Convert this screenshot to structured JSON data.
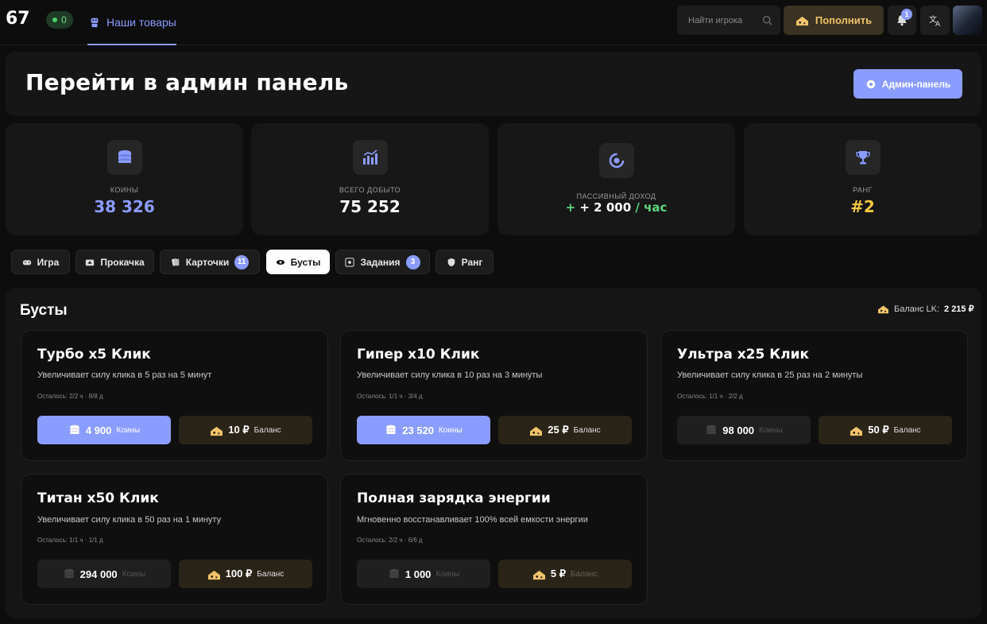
{
  "header": {
    "logo": "67",
    "online_count": "0",
    "nav_tab": "Наши товары",
    "search_placeholder": "Найти игрока",
    "topup_label": "Пополнить",
    "notifications_count": "1",
    "colors": {
      "accent": "#8b9cff",
      "gold": "#f1c46b",
      "online": "#42d26a"
    }
  },
  "admin": {
    "title": "Перейти в админ панель",
    "button_label": "Админ-панель"
  },
  "stats": [
    {
      "label": "Коины",
      "value": "38 326",
      "color": "#8b9cff",
      "icon": "coins-icon"
    },
    {
      "label": "Всего добыто",
      "value": "75 252",
      "color": "#ffffff",
      "icon": "chart-icon"
    },
    {
      "label": "Пассивный доход",
      "value_main": "+ 2 000",
      "value_unit": "/ час",
      "color": "#5fd67b",
      "icon": "passive-icon"
    },
    {
      "label": "Ранг",
      "value": "#2",
      "color": "#f5c842",
      "icon": "trophy-icon"
    }
  ],
  "tabs": [
    {
      "label": "Игра",
      "icon": "gamepad-icon"
    },
    {
      "label": "Прокачка",
      "icon": "upgrade-icon"
    },
    {
      "label": "Карточки",
      "badge": "11",
      "icon": "cards-icon"
    },
    {
      "label": "Бусты",
      "active": true,
      "icon": "boost-icon"
    },
    {
      "label": "Задания",
      "badge": "3",
      "icon": "tasks-icon"
    },
    {
      "label": "Ранг",
      "icon": "shield-icon"
    }
  ],
  "boosts": {
    "title": "Бусты",
    "balance_label": "Баланс LK:",
    "balance_value": "2 215 ₽",
    "cards": [
      {
        "title": "Турбо x5 Клик",
        "desc": "Увеличивает силу клика в 5 раз на 5 минут",
        "left": "Осталось: 2/2 ч · 8/8 д",
        "coins_price": "4 900",
        "coins_unit": "Коины",
        "coins_enabled": true,
        "rub_price": "10 ₽",
        "rub_unit": "Баланс",
        "rub_enabled": true
      },
      {
        "title": "Гипер x10 Клик",
        "desc": "Увеличивает силу клика в 10 раз на 3 минуты",
        "left": "Осталось: 1/1 ч · 3/4 д",
        "coins_price": "23 520",
        "coins_unit": "Коины",
        "coins_enabled": true,
        "rub_price": "25 ₽",
        "rub_unit": "Баланс",
        "rub_enabled": true
      },
      {
        "title": "Ультра x25 Клик",
        "desc": "Увеличивает силу клика в 25 раз на 2 минуты",
        "left": "Осталось: 1/1 ч · 2/2 д",
        "coins_price": "98 000",
        "coins_unit": "Коины",
        "coins_enabled": false,
        "rub_price": "50 ₽",
        "rub_unit": "Баланс",
        "rub_enabled": true
      },
      {
        "title": "Титан x50 Клик",
        "desc": "Увеличивает силу клика в 50 раз на 1 минуту",
        "left": "Осталось: 1/1 ч · 1/1 д",
        "coins_price": "294 000",
        "coins_unit": "Коины",
        "coins_enabled": false,
        "rub_price": "100 ₽",
        "rub_unit": "Баланс",
        "rub_enabled": true
      },
      {
        "title": "Полная зарядка энергии",
        "desc": "Мгновенно восстанавливает 100% всей емкости энергии",
        "left": "Осталось: 2/2 ч · 6/6 д",
        "coins_price": "1 000",
        "coins_unit": "Коины",
        "coins_enabled": false,
        "rub_price": "5 ₽",
        "rub_unit": "Баланс",
        "rub_enabled": false
      }
    ]
  }
}
